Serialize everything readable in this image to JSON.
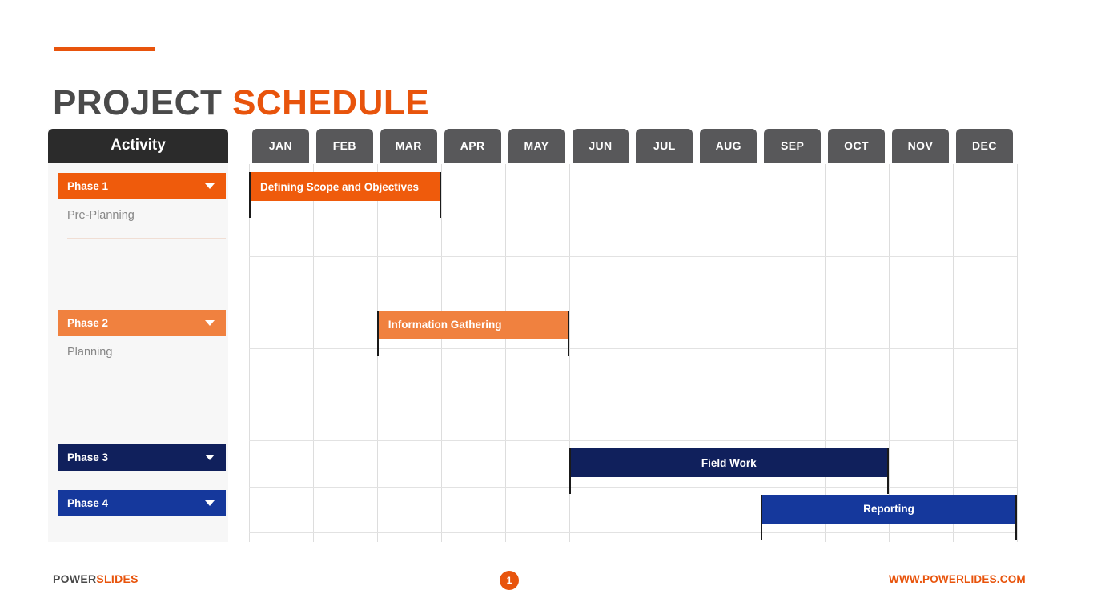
{
  "title": {
    "part1": "PROJECT",
    "part2": "SCHEDULE"
  },
  "sidebar": {
    "header": "Activity",
    "phases": [
      {
        "label": "Phase 1",
        "sub": "Pre-Planning",
        "color": "#ef5b0c",
        "chevron": "chevron-down-icon"
      },
      {
        "label": "Phase 2",
        "sub": "Planning",
        "color": "#f0813f",
        "chevron": "chevron-down-icon"
      },
      {
        "label": "Phase 3",
        "sub": "",
        "color": "#10205c",
        "chevron": "chevron-down-icon"
      },
      {
        "label": "Phase 4",
        "sub": "",
        "color": "#15389c",
        "chevron": "chevron-down-icon"
      }
    ]
  },
  "footer": {
    "logo_part1": "POWER",
    "logo_part2": "SLIDES",
    "page_number": "1",
    "url": "WWW.POWERLIDES.COM"
  },
  "chart_data": {
    "type": "bar",
    "title": "PROJECT SCHEDULE",
    "xlabel": "",
    "ylabel": "Activity",
    "categories": [
      "JAN",
      "FEB",
      "MAR",
      "APR",
      "MAY",
      "JUN",
      "JUL",
      "AUG",
      "SEP",
      "OCT",
      "NOV",
      "DEC"
    ],
    "grid": true,
    "legend": "none",
    "rows": 8,
    "tasks": [
      {
        "name": "Defining Scope and Objectives",
        "phase": "Phase 1",
        "start_month": "JAN",
        "end_month": "MAR",
        "start_index": 0,
        "end_index": 3,
        "row": 0,
        "color": "#ef5b0c",
        "align": "left"
      },
      {
        "name": "Information Gathering",
        "phase": "Phase 2",
        "start_month": "MAR",
        "end_month": "MAY",
        "start_index": 2,
        "end_index": 5,
        "row": 3,
        "color": "#f0813f",
        "align": "left"
      },
      {
        "name": "Field Work",
        "phase": "Phase 3",
        "start_month": "JUN",
        "end_month": "SEP",
        "start_index": 5,
        "end_index": 10,
        "row": 6,
        "color": "#10205c",
        "align": "center"
      },
      {
        "name": "Reporting",
        "phase": "Phase 4",
        "start_month": "SEP",
        "end_month": "DEC",
        "start_index": 8,
        "end_index": 12,
        "row": 7,
        "color": "#15389c",
        "align": "center"
      }
    ]
  }
}
